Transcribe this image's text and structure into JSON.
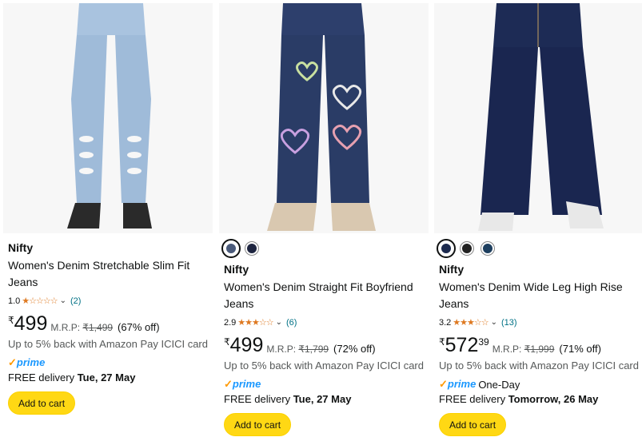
{
  "products": [
    {
      "brand": "Nifty",
      "title_line1": "Women's Denim Stretchable Slim Fit",
      "title_line2": "Jeans",
      "rating": "1.0",
      "stars": "★☆☆☆☆",
      "reviews": "(2)",
      "currency": "₹",
      "price_whole": "499",
      "price_fraction": "",
      "mrp_label": "M.R.P:",
      "mrp_value": "₹1,499",
      "discount": "(67% off)",
      "cashback": "Up to 5% back with Amazon Pay ICICI card",
      "prime_check": "✓",
      "prime_label": "prime",
      "prime_extra": "",
      "delivery_prefix": "FREE delivery ",
      "delivery_date": "Tue, 27 May",
      "button": "Add to cart",
      "swatches": []
    },
    {
      "brand": "Nifty",
      "title_line1": "Women's Denim Straight Fit Boyfriend",
      "title_line2": "Jeans",
      "rating": "2.9",
      "stars": "★★★☆☆",
      "reviews": "(6)",
      "currency": "₹",
      "price_whole": "499",
      "price_fraction": "",
      "mrp_label": "M.R.P:",
      "mrp_value": "₹1,799",
      "discount": "(72% off)",
      "cashback": "Up to 5% back with Amazon Pay ICICI card",
      "prime_check": "✓",
      "prime_label": "prime",
      "prime_extra": "",
      "delivery_prefix": "FREE delivery ",
      "delivery_date": "Tue, 27 May",
      "button": "Add to cart",
      "swatches": [
        "#4a5a7a",
        "#1e2540"
      ]
    },
    {
      "brand": "Nifty",
      "title_line1": "Women's Denim Wide Leg High Rise",
      "title_line2": "Jeans",
      "rating": "3.2",
      "stars": "★★★☆☆",
      "reviews": "(13)",
      "currency": "₹",
      "price_whole": "572",
      "price_fraction": "39",
      "mrp_label": "M.R.P:",
      "mrp_value": "₹1,999",
      "discount": "(71% off)",
      "cashback": "Up to 5% back with Amazon Pay ICICI card",
      "prime_check": "✓",
      "prime_label": "prime",
      "prime_extra": "One-Day",
      "delivery_prefix": "FREE delivery ",
      "delivery_date": "Tomorrow, 26 May",
      "button": "Add to cart",
      "swatches": [
        "#1c2a4e",
        "#222222",
        "#1d3e5e"
      ]
    }
  ],
  "colors": {
    "star": "#de7921",
    "link": "#007185",
    "prime_blue": "#1a98ff",
    "prime_check": "#ff9900",
    "button": "#ffd814"
  }
}
